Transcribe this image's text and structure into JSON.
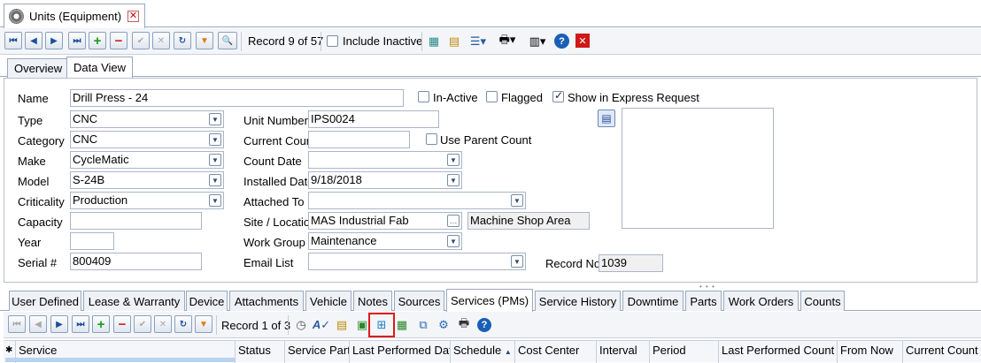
{
  "doc_tab": {
    "title": "Units (Equipment)",
    "icon": "gear-icon"
  },
  "toolbar": {
    "record_text": "Record 9 of 57",
    "include_inactive_label": "Include Inactive",
    "include_inactive_checked": false
  },
  "view_tabs": [
    "Overview",
    "Data View"
  ],
  "active_view_tab": "Data View",
  "form": {
    "name_label": "Name",
    "name_value": "Drill Press - 24",
    "inactive_label": "In-Active",
    "flagged_label": "Flagged",
    "express_label": "Show in Express Request",
    "type_label": "Type",
    "type_value": "CNC",
    "category_label": "Category",
    "category_value": "CNC",
    "make_label": "Make",
    "make_value": "CycleMatic",
    "model_label": "Model",
    "model_value": "S-24B",
    "criticality_label": "Criticality",
    "criticality_value": "Production",
    "capacity_label": "Capacity",
    "capacity_value": "",
    "year_label": "Year",
    "year_value": "",
    "serial_label": "Serial #",
    "serial_value": "800409",
    "unit_number_label": "Unit Number",
    "unit_number_value": "IPS0024",
    "current_count_label": "Current Count",
    "current_count_value": "",
    "use_parent_count_label": "Use Parent Count",
    "count_date_label": "Count Date",
    "count_date_value": "",
    "installed_date_label": "Installed Date",
    "installed_date_value": "9/18/2018",
    "attached_to_label": "Attached To",
    "attached_to_value": "",
    "site_label": "Site / Location",
    "site_value": "MAS Industrial Fab",
    "site_area": "Machine Shop Area",
    "work_group_label": "Work Group",
    "work_group_value": "Maintenance",
    "email_list_label": "Email List",
    "email_list_value": "",
    "record_no_label": "Record No",
    "record_no_value": "1039"
  },
  "bottom_tabs": [
    "User Defined",
    "Lease & Warranty",
    "Device",
    "Attachments",
    "Vehicle",
    "Notes",
    "Sources",
    "Services (PMs)",
    "Service History",
    "Downtime",
    "Parts",
    "Work Orders",
    "Counts"
  ],
  "active_bottom_tab": "Services (PMs)",
  "sub_toolbar": {
    "record_text": "Record 1 of 3"
  },
  "grid_columns": [
    "Service",
    "Status",
    "Service Part",
    "Last Performed Date",
    "Schedule",
    "Cost Center",
    "Interval",
    "Period",
    "Last Performed Count",
    "From Now",
    "Current Count"
  ],
  "sort_indicator": "▲"
}
